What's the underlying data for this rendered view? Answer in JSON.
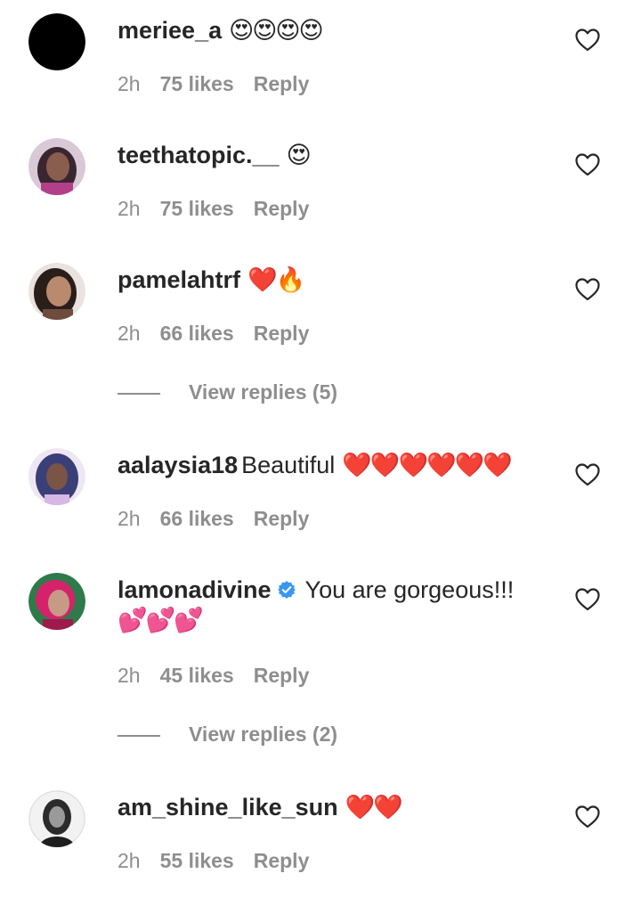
{
  "comments": [
    {
      "username": "meriee_a",
      "text": "",
      "emojis": "😍😍😍😍",
      "time": "2h",
      "likes": "75 likes",
      "reply": "Reply",
      "avatar_color": "#000000"
    },
    {
      "username": "teethatopic.__",
      "text": "",
      "emojis": "😍",
      "time": "2h",
      "likes": "75 likes",
      "reply": "Reply",
      "avatar_color": "#6b4a5a"
    },
    {
      "username": "pamelahtrf",
      "text": "",
      "emojis": "❤️🔥",
      "time": "2h",
      "likes": "66 likes",
      "reply": "Reply",
      "avatar_color": "#8a6a5a",
      "view_replies": "View replies (5)"
    },
    {
      "username": "aalaysia18",
      "text": "Beautiful",
      "emojis": "❤️❤️❤️❤️❤️❤️",
      "time": "2h",
      "likes": "66 likes",
      "reply": "Reply",
      "avatar_color": "#b9a7d6"
    },
    {
      "username": "lamonadivine",
      "verified": true,
      "text": "You are gorgeous!!!",
      "emojis_line2": "💕💕💕",
      "time": "2h",
      "likes": "45 likes",
      "reply": "Reply",
      "avatar_color": "#c23a5a",
      "view_replies": "View replies (2)"
    },
    {
      "username": "am_shine_like_sun",
      "text": "",
      "emojis": "❤️❤️",
      "time": "2h",
      "likes": "55 likes",
      "reply": "Reply",
      "avatar_color": "#3a3a3a"
    }
  ],
  "icons": {
    "like": "heart-outline-icon",
    "verified": "verified-badge-icon"
  },
  "colors": {
    "text": "#262626",
    "secondary": "#8e8e8e",
    "verified": "#3897f0",
    "heart": "#e0171f"
  }
}
